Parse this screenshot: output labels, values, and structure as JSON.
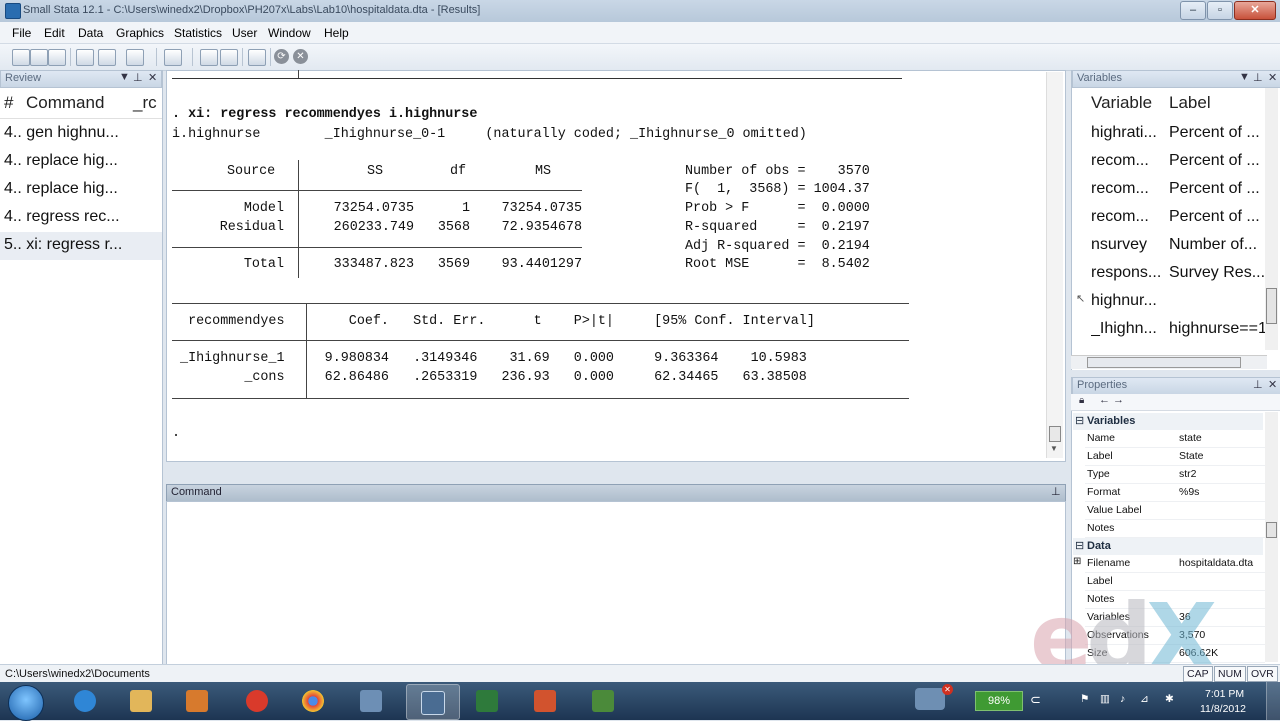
{
  "window": {
    "title": "Small Stata 12.1 - C:\\Users\\winedx2\\Dropbox\\PH207x\\Labs\\Lab10\\hospitaldata.dta - [Results]",
    "controls": {
      "min": "–",
      "max": "▫",
      "close": "✕"
    }
  },
  "menu": [
    "File",
    "Edit",
    "Data",
    "Graphics",
    "Statistics",
    "User",
    "Window",
    "Help"
  ],
  "review": {
    "title": "Review",
    "header_num": "#",
    "header_cmd": "Command",
    "header_rc": "_rc",
    "rows": [
      "4.. gen highnu...",
      "4.. replace hig...",
      "4.. replace hig...",
      "4.. regress rec...",
      "5.. xi: regress r..."
    ]
  },
  "results": {
    "command_line": ". xi: regress recommendyes i.highnurse",
    "xi_line": "i.highnurse        _Ihighnurse_0-1     (naturally coded; _Ihighnurse_0 omitted)",
    "anova_header": {
      "source": "Source",
      "ss": "SS",
      "df": "df",
      "ms": "MS"
    },
    "anova_rows": [
      {
        "source": "Model",
        "ss": "73254.0735",
        "df": "1",
        "ms": "73254.0735"
      },
      {
        "source": "Residual",
        "ss": "260233.749",
        "df": "3568",
        "ms": "72.9354678"
      },
      {
        "source": "Total",
        "ss": "333487.823",
        "df": "3569",
        "ms": "93.4401297"
      }
    ],
    "stats": [
      "Number of obs =    3570",
      "F(  1,  3568) = 1004.37",
      "Prob > F      =  0.0000",
      "R-squared     =  0.2197",
      "Adj R-squared =  0.2194",
      "Root MSE      =  8.5402"
    ],
    "coef_header": "  recommendyes        Coef.   Std. Err.      t    P>|t|     [95% Conf. Interval]",
    "coef_rows": [
      " _Ihighnurse_1     9.980834   .3149346    31.69   0.000     9.363364    10.5983",
      "         _cons     62.86486   .2653319   236.93   0.000     62.34465   63.38508"
    ],
    "prompt": "."
  },
  "command_window": {
    "title": "Command"
  },
  "variables": {
    "title": "Variables",
    "header_var": "Variable",
    "header_label": "Label",
    "rows": [
      {
        "name": "highrati...",
        "label": "Percent of ..."
      },
      {
        "name": "recom...",
        "label": "Percent of ..."
      },
      {
        "name": "recom...",
        "label": "Percent of ..."
      },
      {
        "name": "recom...",
        "label": "Percent of ..."
      },
      {
        "name": "nsurvey",
        "label": "Number of..."
      },
      {
        "name": "respons...",
        "label": "Survey Res..."
      },
      {
        "name": "highnur...",
        "label": ""
      },
      {
        "name": "_Ihighn...",
        "label": "highnurse==1"
      }
    ]
  },
  "properties": {
    "title": "Properties",
    "variables_section": "Variables",
    "variables_rows": [
      {
        "key": "Name",
        "value": "state"
      },
      {
        "key": "Label",
        "value": "State"
      },
      {
        "key": "Type",
        "value": "str2"
      },
      {
        "key": "Format",
        "value": "%9s"
      },
      {
        "key": "Value Label",
        "value": ""
      },
      {
        "key": "Notes",
        "value": ""
      }
    ],
    "data_section": "Data",
    "data_rows": [
      {
        "key": "Filename",
        "value": "hospitaldata.dta"
      },
      {
        "key": "Label",
        "value": ""
      },
      {
        "key": "Notes",
        "value": ""
      },
      {
        "key": "Variables",
        "value": "36"
      },
      {
        "key": "Observations",
        "value": "3,570"
      },
      {
        "key": "Size",
        "value": "606.62K"
      }
    ]
  },
  "status": {
    "path": "C:\\Users\\winedx2\\Documents",
    "cap": "CAP",
    "num": "NUM",
    "ovr": "OVR"
  },
  "taskbar": {
    "battery": "98%",
    "time": "7:01 PM",
    "date": "11/8/2012"
  },
  "watermark": {
    "e": "e",
    "d": "d",
    "x": "X"
  }
}
